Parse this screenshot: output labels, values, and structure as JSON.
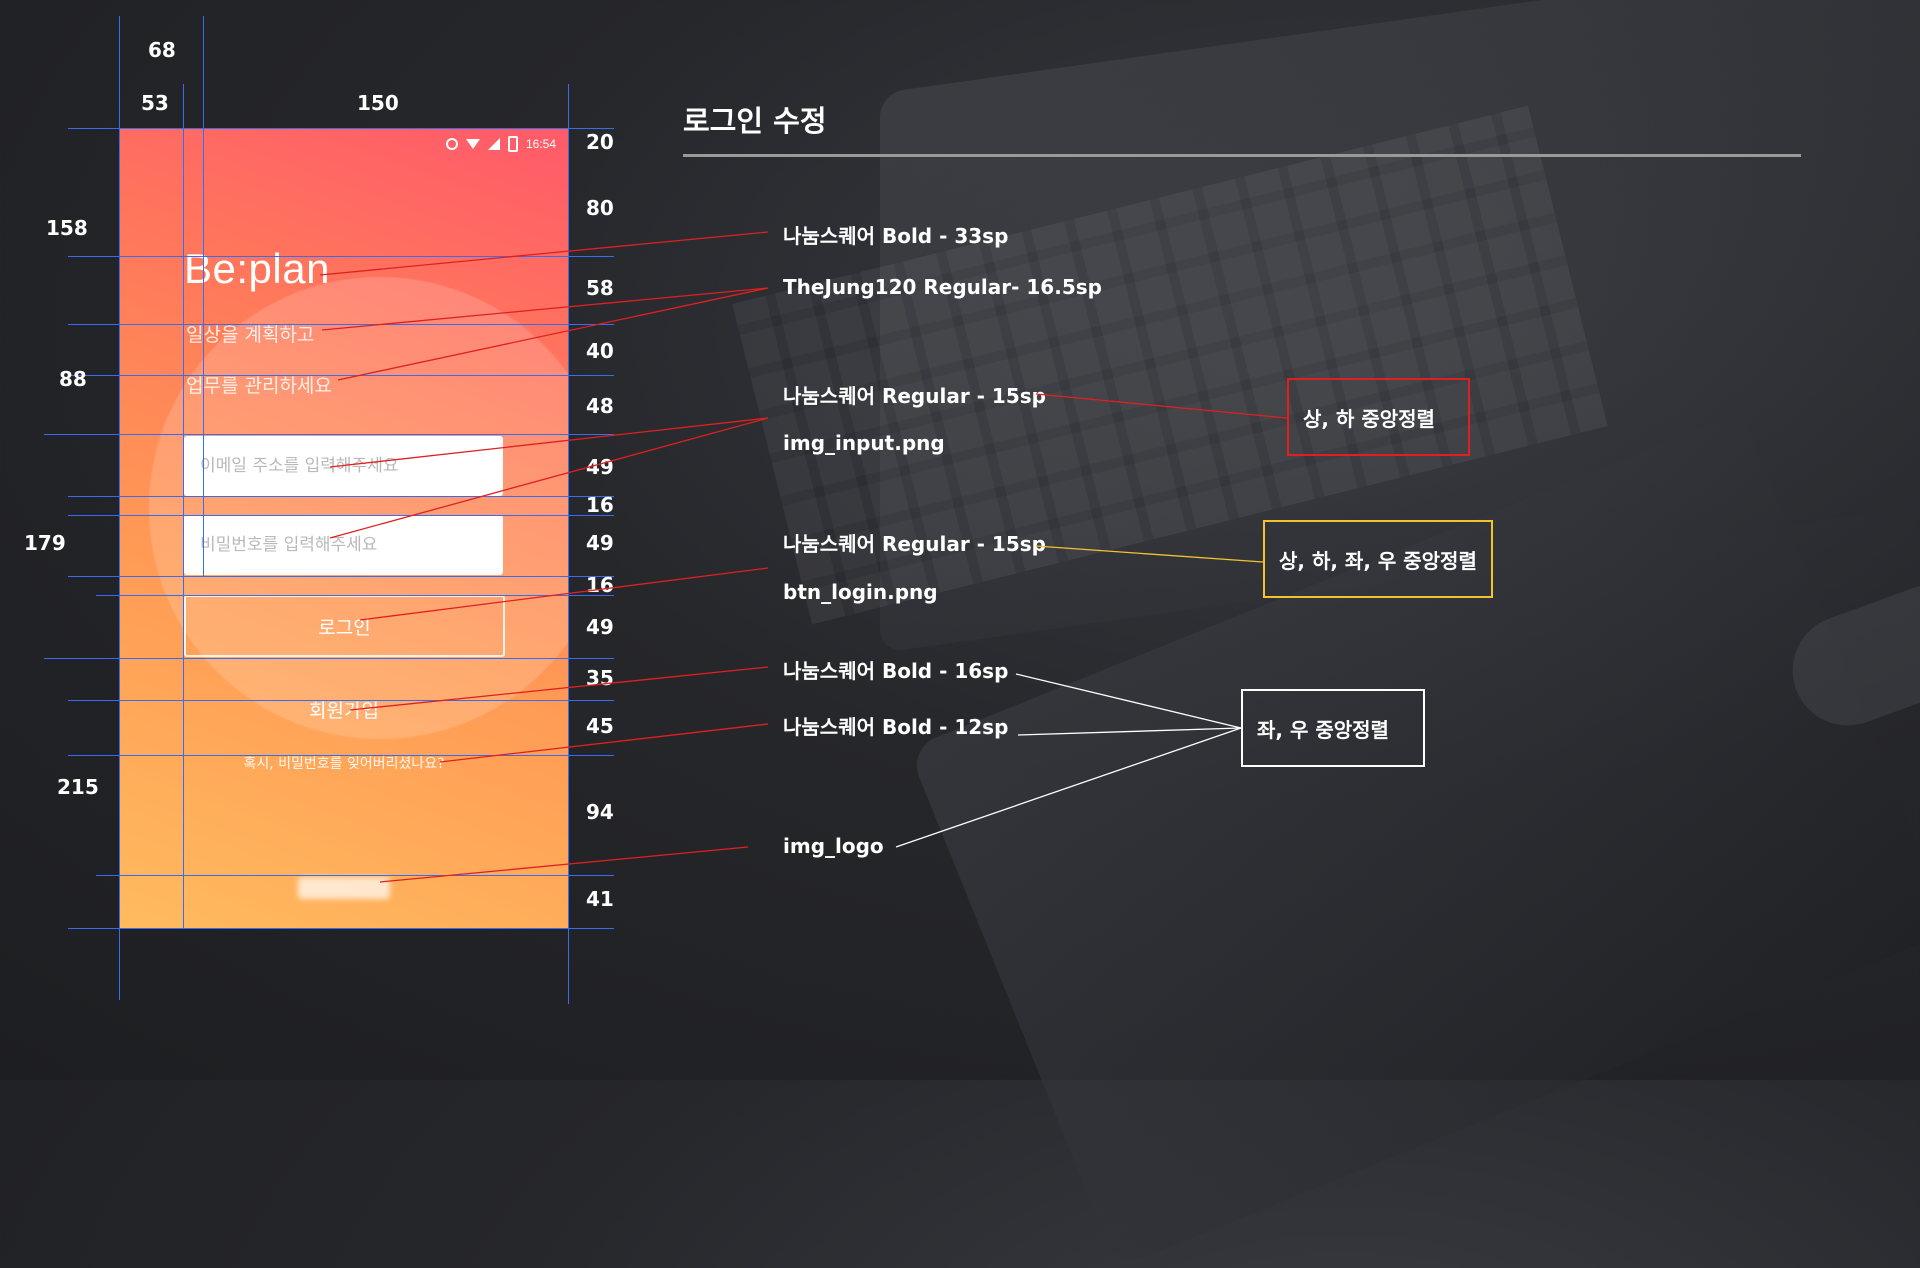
{
  "phone": {
    "status_time": "16:54",
    "app_title": "Be:plan",
    "tagline_1": "일상을 계획하고",
    "tagline_2": "업무를 관리하세요",
    "email_placeholder": "이메일 주소를 입력해주세요",
    "password_placeholder": "비밀번호를 입력해주세요",
    "login_label": "로그인",
    "signup_label": "회원가입",
    "forgot_label": "혹시, 비밀번호를 잊어버리셨나요?"
  },
  "measurements": {
    "top": [
      "68",
      "53",
      "150"
    ],
    "left": [
      "158",
      "88",
      "179",
      "215"
    ],
    "right": [
      "20",
      "80",
      "58",
      "40",
      "48",
      "49",
      "16",
      "49",
      "16",
      "49",
      "35",
      "45",
      "94",
      "41"
    ]
  },
  "spec_panel": {
    "title": "로그인 수정",
    "specs": [
      "나눔스퀘어 Bold - 33sp",
      "TheJung120 Regular- 16.5sp",
      "나눔스퀘어 Regular - 15sp",
      "img_input.png",
      "나눔스퀘어 Regular - 15sp",
      "btn_login.png",
      "나눔스퀘어 Bold - 16sp",
      "나눔스퀘어 Bold - 12sp",
      "img_logo"
    ],
    "align_boxes": {
      "vertical_center": "상, 하 중앙정렬",
      "all_center": "상, 하, 좌, 우 중앙정렬",
      "horizontal_center": "좌, 우 중앙정렬"
    }
  },
  "colors": {
    "guide_line": "#3a6cf0",
    "annotation_red": "#e02020",
    "box_yellow": "#f2c230",
    "gradient_top": "#ff5a6a",
    "gradient_bottom": "#ffbb5e"
  }
}
